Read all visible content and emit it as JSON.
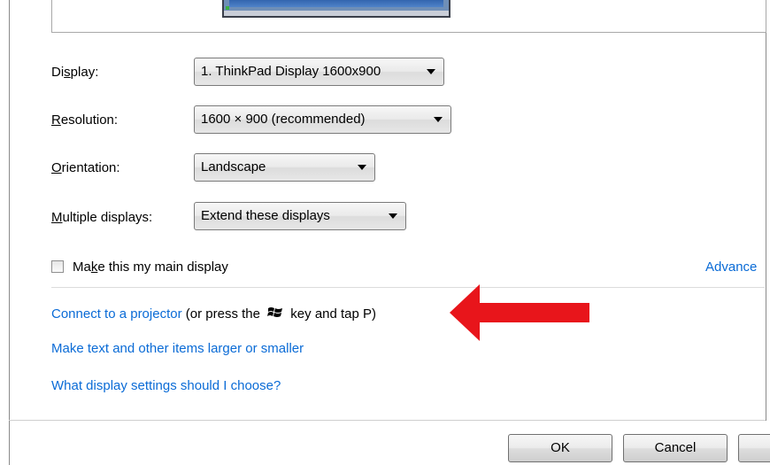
{
  "display": {
    "label": "Display:",
    "value": "1. ThinkPad Display 1600x900"
  },
  "resolution": {
    "label": "Resolution:",
    "value": "1600 × 900 (recommended)"
  },
  "orientation": {
    "label": "Orientation:",
    "value": "Landscape"
  },
  "multiple_displays": {
    "label": "Multiple displays:",
    "value": "Extend these displays"
  },
  "main_display": {
    "label": "Make this my main display",
    "checked": false
  },
  "advanced_link": "Advance",
  "projector": {
    "link": "Connect to a projector",
    "hint_before": " (or press the ",
    "hint_after": " key and tap P)"
  },
  "text_size_link": "Make text and other items larger or smaller",
  "help_link": "What display settings should I choose?",
  "buttons": {
    "ok": "OK",
    "cancel": "Cancel"
  },
  "colors": {
    "link": "#0a6bd6",
    "annotation_arrow": "#e8151b"
  },
  "icons": {
    "windows_key": "windows-logo-icon",
    "annotation": "red-arrow-icon"
  }
}
